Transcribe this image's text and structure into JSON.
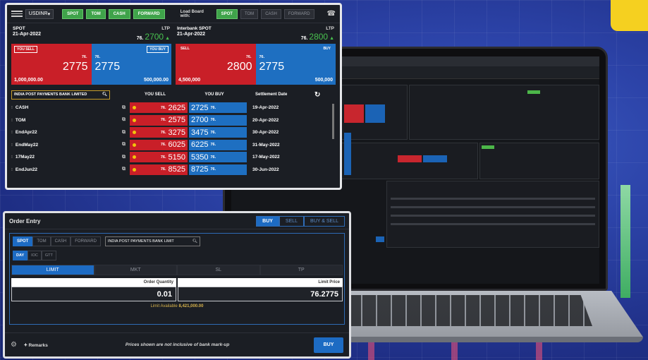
{
  "rate_board": {
    "currency": "USDINR",
    "segments": [
      "SPOT",
      "TOM",
      "CASH",
      "FORWARD"
    ],
    "load_board_label": "Load Board with:",
    "load_segments": [
      "SPOT",
      "TOM",
      "CASH",
      "FORWARD"
    ],
    "spot": {
      "label": "SPOT",
      "date": "21-Apr-2022",
      "ltp_label": "LTP",
      "ltp_pre": "76.",
      "ltp_big": "2700",
      "sell_tag": "YOU SELL",
      "buy_tag": "YOU BUY",
      "sell_pre": "76.",
      "sell_big": "2775",
      "buy_pre": "76.",
      "buy_big": "2775",
      "sell_qty": "1,000,000.00",
      "buy_qty": "500,000.00"
    },
    "interbank": {
      "label": "Interbank SPOT",
      "date": "21-Apr-2022",
      "ltp_label": "LTP",
      "ltp_pre": "76.",
      "ltp_big": "2800",
      "sell_tag": "SELL",
      "buy_tag": "BUY",
      "sell_pre": "76.",
      "sell_big": "2800",
      "buy_pre": "76.",
      "buy_big": "2775",
      "sell_qty": "4,500,000",
      "buy_qty": "500,000"
    },
    "search_value": "INDIA POST PAYMENTS BANK LIMITED",
    "columns": {
      "you_sell": "YOU SELL",
      "you_buy": "YOU BUY",
      "settlement": "Settlement Date"
    },
    "rows": [
      {
        "name": "CASH",
        "sell_pre": "76.",
        "sell_big": "2625",
        "buy_big": "2725",
        "buy_post": "76.",
        "date": "19-Apr-2022"
      },
      {
        "name": "TOM",
        "sell_pre": "76.",
        "sell_big": "2575",
        "buy_big": "2700",
        "buy_post": "76.",
        "date": "20-Apr-2022"
      },
      {
        "name": "EndApr22",
        "sell_pre": "76.",
        "sell_big": "3275",
        "buy_big": "3475",
        "buy_post": "76.",
        "date": "30-Apr-2022"
      },
      {
        "name": "EndMay22",
        "sell_pre": "76.",
        "sell_big": "6025",
        "buy_big": "6225",
        "buy_post": "76.",
        "date": "31-May-2022"
      },
      {
        "name": "17May22",
        "sell_pre": "76.",
        "sell_big": "5150",
        "buy_big": "5350",
        "buy_post": "76.",
        "date": "17-May-2022"
      },
      {
        "name": "EndJun22",
        "sell_pre": "76.",
        "sell_big": "8525",
        "buy_big": "8725",
        "buy_post": "76.",
        "date": "30-Jun-2022"
      }
    ]
  },
  "order_entry": {
    "title": "Order Entry",
    "sides": [
      "BUY",
      "SELL",
      "BUY & SELL"
    ],
    "tenors": [
      "SPOT",
      "TOM",
      "CASH",
      "FORWARD"
    ],
    "search_value": "INDIA POST PAYMENTS BANK LIMIT",
    "validity": [
      "DAY",
      "IOC",
      "GTT"
    ],
    "order_types": [
      "LIMIT",
      "MKT",
      "SL",
      "TP"
    ],
    "qty_label": "Order Quantity",
    "qty_value": "0.01",
    "price_label": "Limit Price",
    "price_value": "76.2775",
    "limit_available_label": "Limit Available",
    "limit_available_value": "8,421,000.00",
    "remarks": "Remarks",
    "disclaimer": "Prices shown are not inclusive of bank mark-up",
    "buy_button": "BUY"
  },
  "icons": {
    "menu": "hamburger-icon",
    "phone": "phone-icon",
    "search": "search-icon",
    "refresh": "refresh-icon",
    "chart": "chart-icon",
    "settings": "settings-icon"
  },
  "colors": {
    "sell": "#c91f28",
    "buy": "#1e6fc1",
    "ltp_up": "#48c24f",
    "accent": "#3fa34a"
  }
}
